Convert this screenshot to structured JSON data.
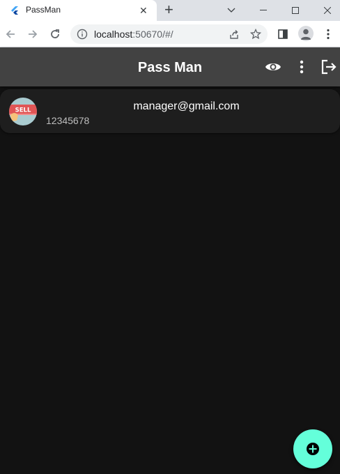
{
  "browser": {
    "tab_title": "PassMan",
    "url_host": "localhost",
    "url_rest": ":50670/#/"
  },
  "app": {
    "title": "Pass Man",
    "accent_color": "#64ffda",
    "appbar_color": "#424242"
  },
  "entries": [
    {
      "avatar_icon": "sell-tag-icon",
      "avatar_text": "SELL",
      "email": "manager@gmail.com",
      "password": "12345678"
    }
  ]
}
